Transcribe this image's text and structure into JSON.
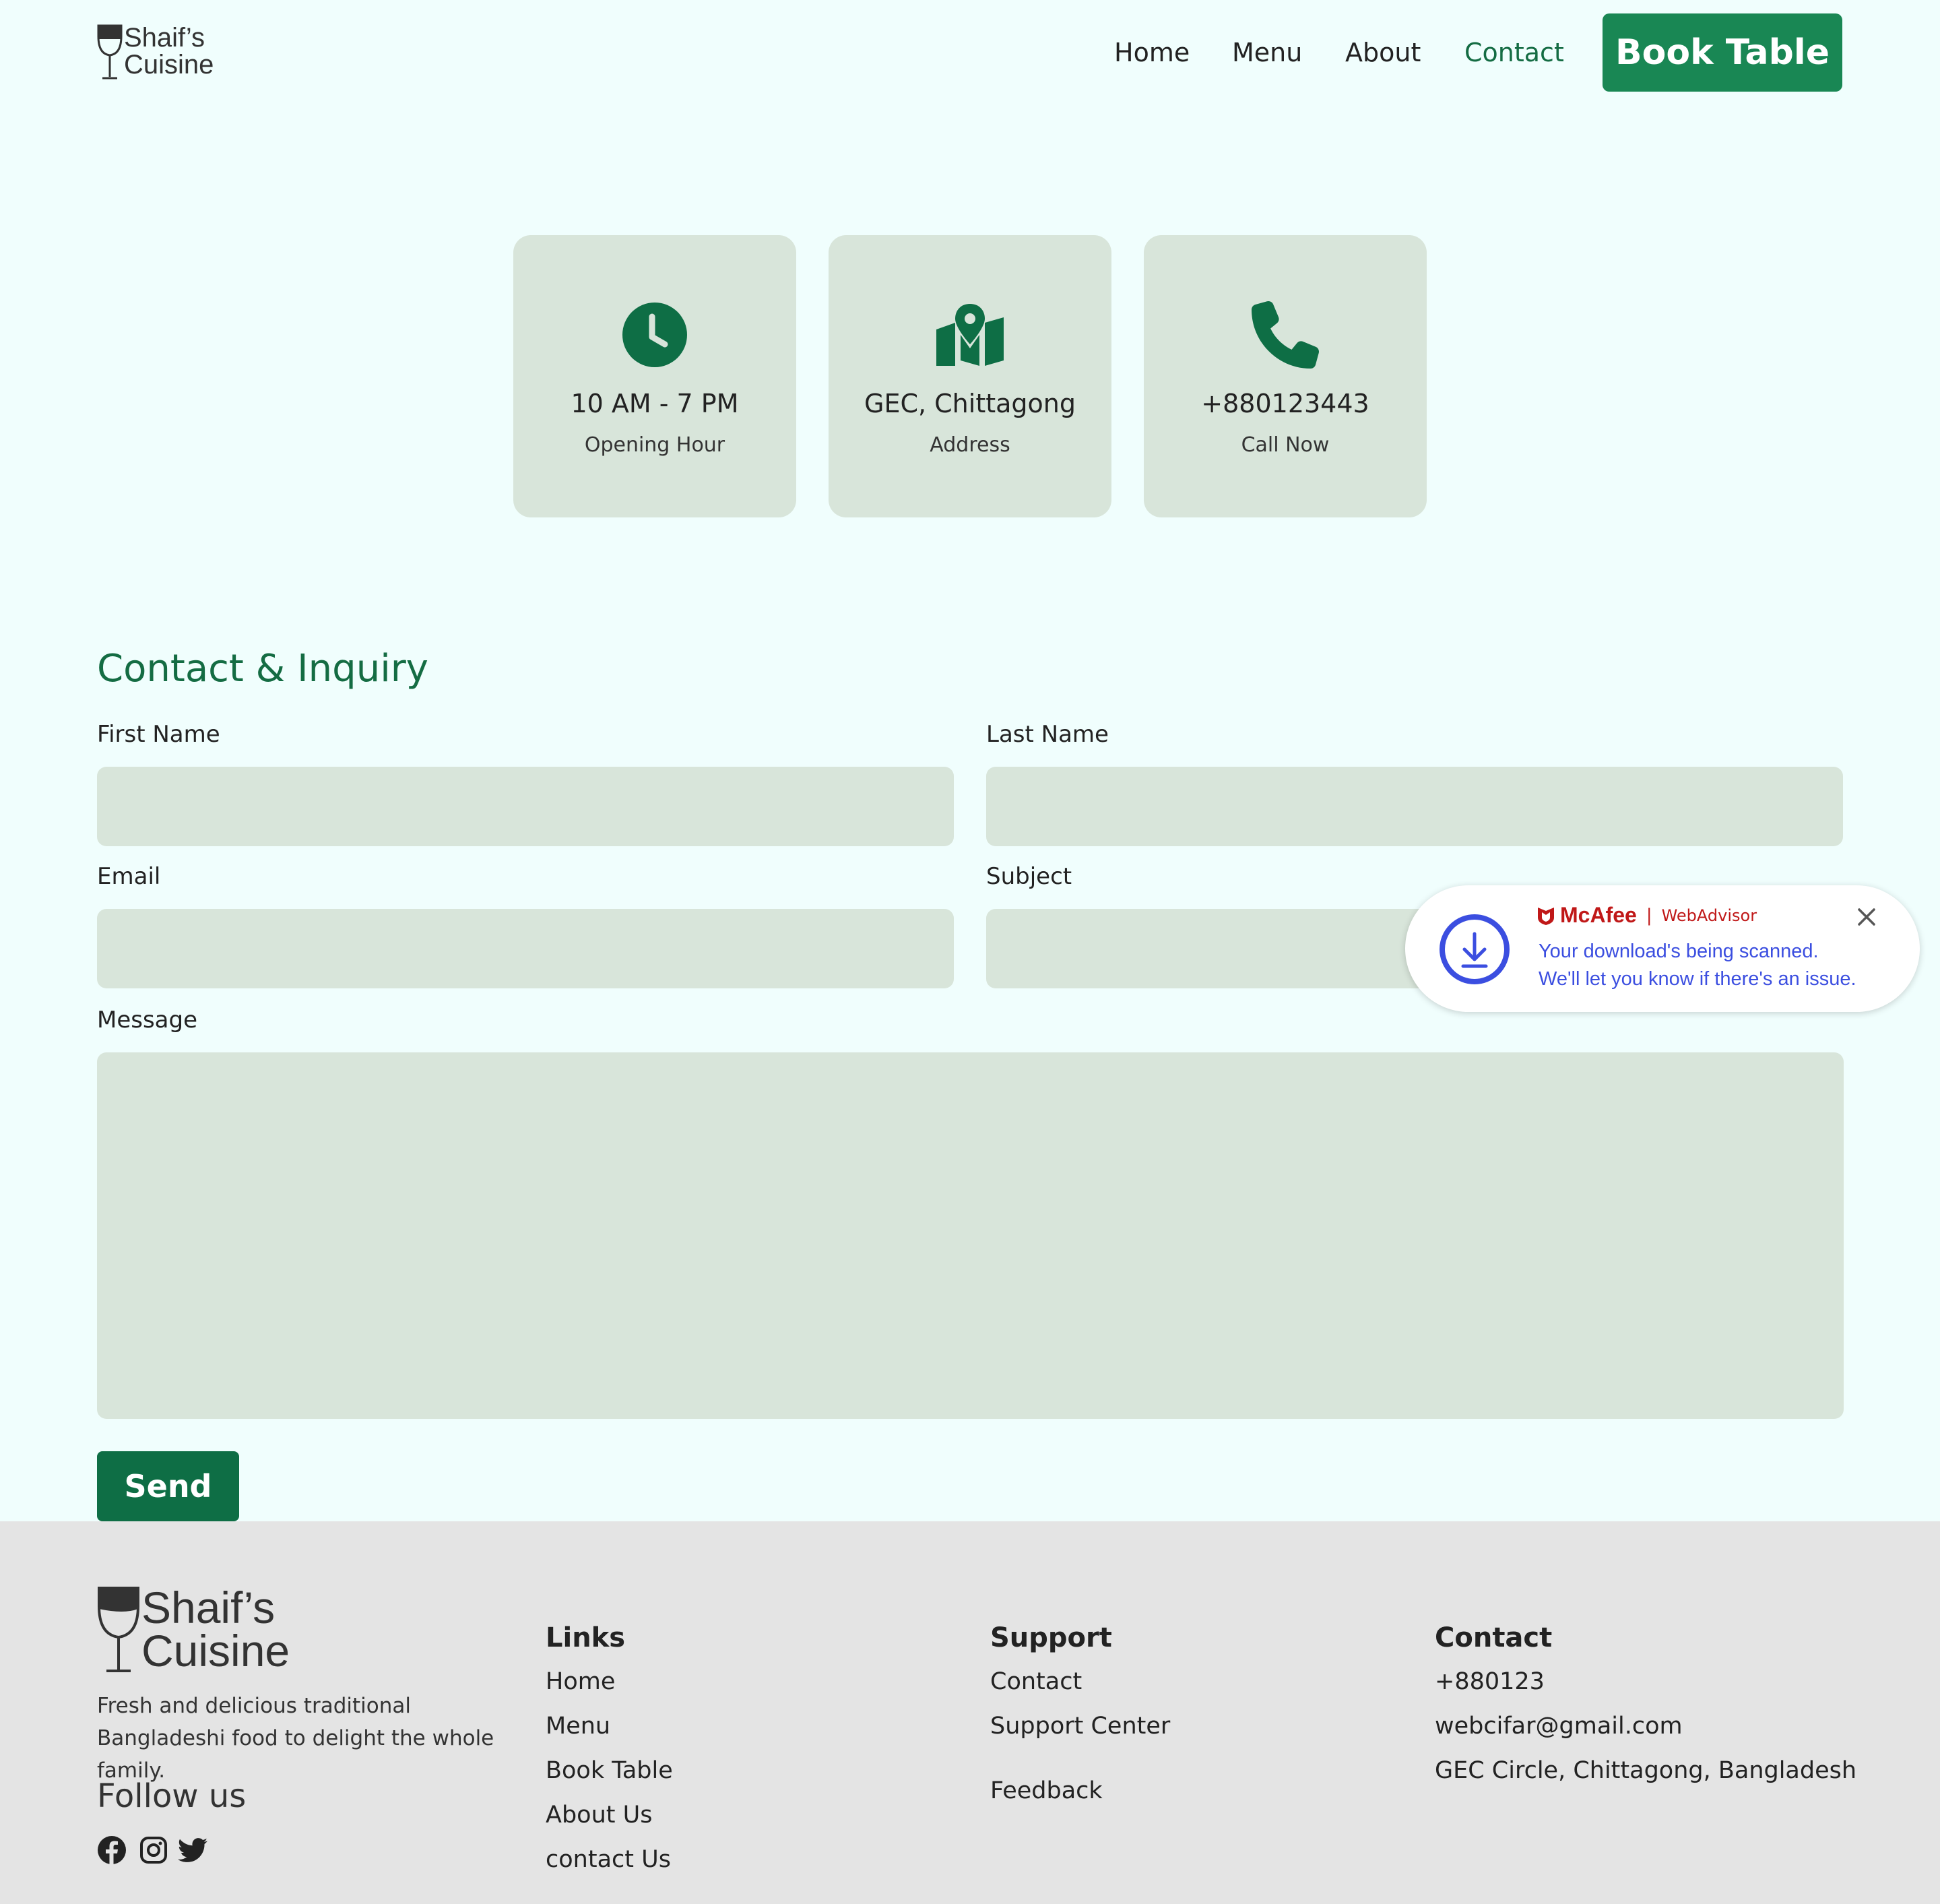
{
  "header": {
    "logo_line1": "Shaif’s",
    "logo_line2": "Cuisine",
    "nav": [
      {
        "label": "Home"
      },
      {
        "label": "Menu"
      },
      {
        "label": "About"
      },
      {
        "label": "Contact",
        "active": true
      }
    ],
    "cta_label": "Book Table"
  },
  "cards": [
    {
      "icon": "clock-icon",
      "title": "10 AM - 7 PM",
      "subtitle": "Opening Hour"
    },
    {
      "icon": "map-pin-icon",
      "title": "GEC, Chittagong",
      "subtitle": "Address"
    },
    {
      "icon": "phone-icon",
      "title": "+880123443",
      "subtitle": "Call Now"
    }
  ],
  "form": {
    "title": "Contact & Inquiry",
    "first_name_label": "First Name",
    "last_name_label": "Last Name",
    "email_label": "Email",
    "subject_label": "Subject",
    "message_label": "Message",
    "first_name_value": "",
    "last_name_value": "",
    "email_value": "",
    "subject_value": "",
    "message_value": "",
    "send_label": "Send"
  },
  "toast": {
    "brand": "McAfee",
    "separator": "|",
    "product": "WebAdvisor",
    "line1": "Your download's being scanned.",
    "line2": "We'll let you know if there's an issue."
  },
  "footer": {
    "logo_line1": "Shaif’s",
    "logo_line2": "Cuisine",
    "description": "Fresh and delicious traditional Bangladeshi food to delight the whole family.",
    "follow_title": "Follow us",
    "links_title": "Links",
    "links": [
      "Home",
      "Menu",
      "Book Table",
      "About Us",
      "contact Us"
    ],
    "support_title": "Support",
    "support": [
      "Contact",
      "Support Center",
      "Feedback"
    ],
    "contact_title": "Contact",
    "contact": [
      "+880123",
      "webcifar@gmail.com",
      "GEC Circle, Chittagong, Bangladesh"
    ]
  },
  "colors": {
    "page_bg": "#f0fefd",
    "accent": "#198754",
    "accent_dark": "#146c43",
    "card_bg": "#d8e5da",
    "footer_bg": "#e4e4e4",
    "toast_text": "#3b4ee0",
    "mcafee_red": "#c01818"
  }
}
